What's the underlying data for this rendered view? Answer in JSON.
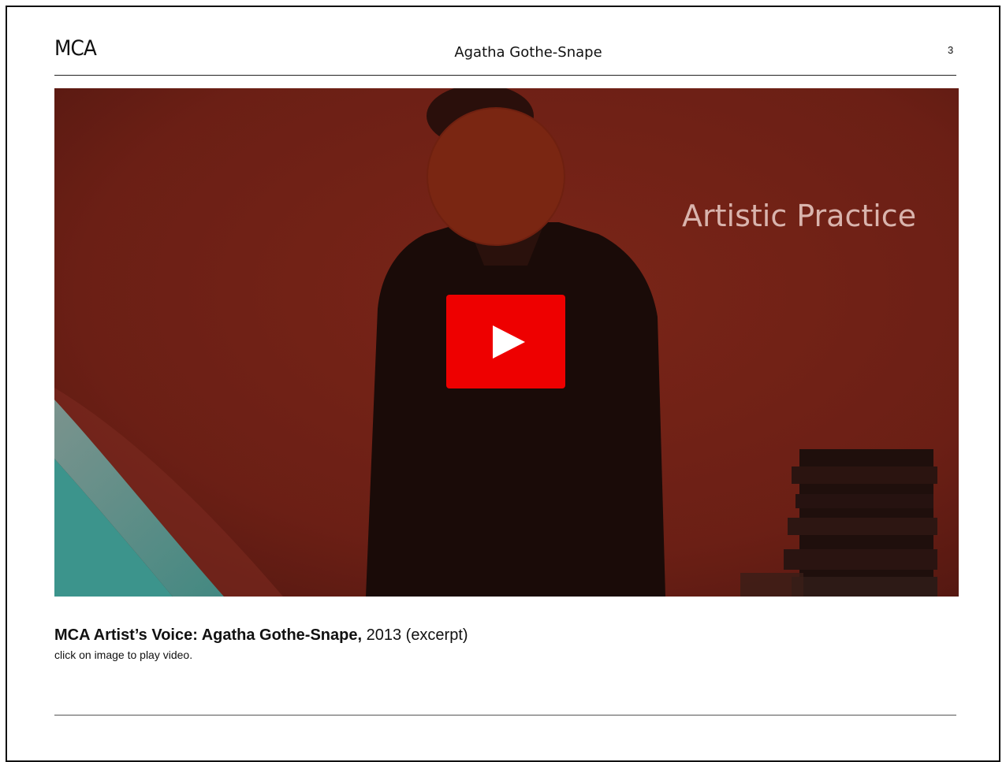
{
  "header": {
    "logo": "MCA",
    "title": "Agatha Gothe-Snape",
    "page_number": "3"
  },
  "video": {
    "overlay_text": "Artistic Practice",
    "play_icon": "play-icon",
    "colors": {
      "background": "#6a1d14",
      "play_button": "#ee0000"
    }
  },
  "caption": {
    "title": "MCA Artist’s Voice: Agatha Gothe-Snape,",
    "details": " 2013 (excerpt)",
    "note": "click on image to play video."
  }
}
